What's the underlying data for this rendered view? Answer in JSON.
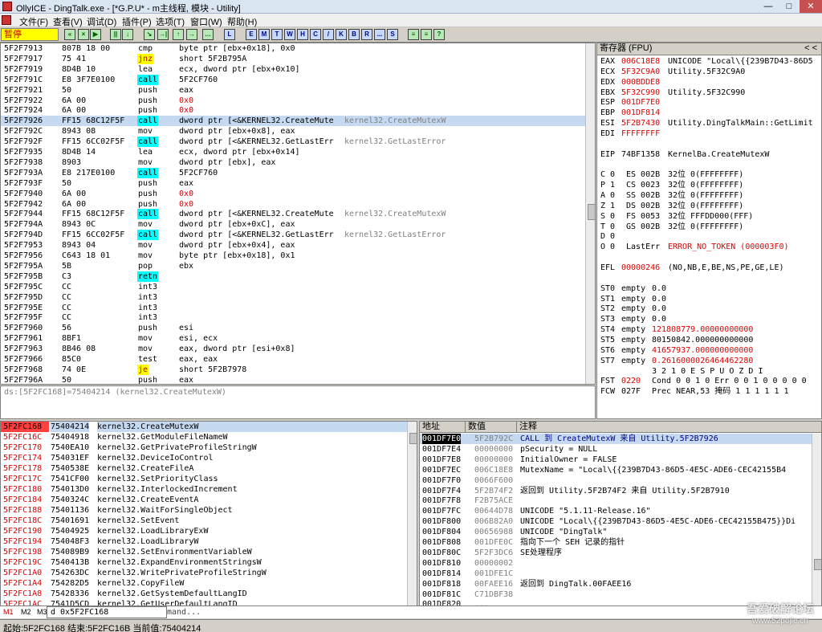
{
  "window": {
    "title": "OllyICE - DingTalk.exe - [*G.P.U* - m主线程, 模块 - Utility]",
    "minimize": "—",
    "maximize": "□",
    "close": "✕"
  },
  "menu": [
    "文件(F)",
    "查看(V)",
    "调试(D)",
    "插件(P)",
    "选项(T)",
    "窗口(W)",
    "帮助(H)"
  ],
  "toolbar": {
    "status": "暂停",
    "buttons": [
      "«",
      "×",
      "▶",
      "||",
      "↓",
      "↘",
      "→|",
      "↑",
      "→",
      "…",
      "L",
      "E",
      "M",
      "T",
      "W",
      "H",
      "C",
      "/",
      "K",
      "B",
      "R",
      "...",
      "S",
      "≡",
      "≡",
      "?"
    ]
  },
  "disasm": {
    "rows": [
      {
        "addr": "5F2F7913",
        "bytes": "807B 18 00",
        "mnem": "cmp",
        "ops": "byte ptr [ebx+0x18], 0x0",
        "cmt": "",
        "kind": "",
        "sel": false
      },
      {
        "addr": "5F2F7917",
        "bytes": "75 41",
        "mnem": "jnz",
        "ops": "short 5F2B795A",
        "cmt": "",
        "kind": "jmp",
        "sel": false
      },
      {
        "addr": "5F2F7919",
        "bytes": "8D4B 10",
        "mnem": "lea",
        "ops": "ecx, dword ptr [ebx+0x10]",
        "cmt": "",
        "kind": "",
        "sel": false
      },
      {
        "addr": "5F2F791C",
        "bytes": "E8 3F7E0100",
        "mnem": "call",
        "ops": "5F2CF760",
        "cmt": "",
        "kind": "call",
        "sel": false
      },
      {
        "addr": "5F2F7921",
        "bytes": "50",
        "mnem": "push",
        "ops": "eax",
        "cmt": "",
        "kind": "",
        "sel": false
      },
      {
        "addr": "5F2F7922",
        "bytes": "6A 00",
        "mnem": "push",
        "ops": "0x0",
        "cmt": "",
        "kind": "",
        "sel": false
      },
      {
        "addr": "5F2F7924",
        "bytes": "6A 00",
        "mnem": "push",
        "ops": "0x0",
        "cmt": "",
        "kind": "",
        "sel": false
      },
      {
        "addr": "5F2F7926",
        "bytes": "FF15 68C12F5F",
        "mnem": "call",
        "ops": "dword ptr [<&KERNEL32.CreateMute",
        "cmt": "kernel32.CreateMutexW",
        "kind": "call",
        "sel": true
      },
      {
        "addr": "5F2F792C",
        "bytes": "8943 08",
        "mnem": "mov",
        "ops": "dword ptr [ebx+0x8], eax",
        "cmt": "",
        "kind": "",
        "sel": false
      },
      {
        "addr": "5F2F792F",
        "bytes": "FF15 6CC02F5F",
        "mnem": "call",
        "ops": "dword ptr [<&KERNEL32.GetLastErr",
        "cmt": "kernel32.GetLastError",
        "kind": "call",
        "sel": false
      },
      {
        "addr": "5F2F7935",
        "bytes": "8D4B 14",
        "mnem": "lea",
        "ops": "ecx, dword ptr [ebx+0x14]",
        "cmt": "",
        "kind": "",
        "sel": false
      },
      {
        "addr": "5F2F7938",
        "bytes": "8903",
        "mnem": "mov",
        "ops": "dword ptr [ebx], eax",
        "cmt": "",
        "kind": "",
        "sel": false
      },
      {
        "addr": "5F2F793A",
        "bytes": "E8 217E0100",
        "mnem": "call",
        "ops": "5F2CF760",
        "cmt": "",
        "kind": "call",
        "sel": false
      },
      {
        "addr": "5F2F793F",
        "bytes": "50",
        "mnem": "push",
        "ops": "eax",
        "cmt": "",
        "kind": "",
        "sel": false
      },
      {
        "addr": "5F2F7940",
        "bytes": "6A 00",
        "mnem": "push",
        "ops": "0x0",
        "cmt": "",
        "kind": "",
        "sel": false
      },
      {
        "addr": "5F2F7942",
        "bytes": "6A 00",
        "mnem": "push",
        "ops": "0x0",
        "cmt": "",
        "kind": "",
        "sel": false
      },
      {
        "addr": "5F2F7944",
        "bytes": "FF15 68C12F5F",
        "mnem": "call",
        "ops": "dword ptr [<&KERNEL32.CreateMute",
        "cmt": "kernel32.CreateMutexW",
        "kind": "call",
        "sel": false
      },
      {
        "addr": "5F2F794A",
        "bytes": "8943 0C",
        "mnem": "mov",
        "ops": "dword ptr [ebx+0xC], eax",
        "cmt": "",
        "kind": "",
        "sel": false
      },
      {
        "addr": "5F2F794D",
        "bytes": "FF15 6CC02F5F",
        "mnem": "call",
        "ops": "dword ptr [<&KERNEL32.GetLastErr",
        "cmt": "kernel32.GetLastError",
        "kind": "call",
        "sel": false
      },
      {
        "addr": "5F2F7953",
        "bytes": "8943 04",
        "mnem": "mov",
        "ops": "dword ptr [ebx+0x4], eax",
        "cmt": "",
        "kind": "",
        "sel": false
      },
      {
        "addr": "5F2F7956",
        "bytes": "C643 18 01",
        "mnem": "mov",
        "ops": "byte ptr [ebx+0x18], 0x1",
        "cmt": "",
        "kind": "",
        "sel": false
      },
      {
        "addr": "5F2F795A",
        "bytes": "5B",
        "mnem": "pop",
        "ops": "ebx",
        "cmt": "",
        "kind": "",
        "sel": false
      },
      {
        "addr": "5F2F795B",
        "bytes": "C3",
        "mnem": "retn",
        "ops": "",
        "cmt": "",
        "kind": "ret",
        "sel": false
      },
      {
        "addr": "5F2F795C",
        "bytes": "CC",
        "mnem": "int3",
        "ops": "",
        "cmt": "",
        "kind": "",
        "sel": false
      },
      {
        "addr": "5F2F795D",
        "bytes": "CC",
        "mnem": "int3",
        "ops": "",
        "cmt": "",
        "kind": "",
        "sel": false
      },
      {
        "addr": "5F2F795E",
        "bytes": "CC",
        "mnem": "int3",
        "ops": "",
        "cmt": "",
        "kind": "",
        "sel": false
      },
      {
        "addr": "5F2F795F",
        "bytes": "CC",
        "mnem": "int3",
        "ops": "",
        "cmt": "",
        "kind": "",
        "sel": false
      },
      {
        "addr": "5F2F7960",
        "bytes": "56",
        "mnem": "push",
        "ops": "esi",
        "cmt": "",
        "kind": "",
        "sel": false
      },
      {
        "addr": "5F2F7961",
        "bytes": "8BF1",
        "mnem": "mov",
        "ops": "esi, ecx",
        "cmt": "",
        "kind": "",
        "sel": false
      },
      {
        "addr": "5F2F7963",
        "bytes": "8B46 08",
        "mnem": "mov",
        "ops": "eax, dword ptr [esi+0x8]",
        "cmt": "",
        "kind": "",
        "sel": false
      },
      {
        "addr": "5F2F7966",
        "bytes": "85C0",
        "mnem": "test",
        "ops": "eax, eax",
        "cmt": "",
        "kind": "",
        "sel": false
      },
      {
        "addr": "5F2F7968",
        "bytes": "74 0E",
        "mnem": "je",
        "ops": "short 5F2B7978",
        "cmt": "",
        "kind": "jmp",
        "sel": false
      },
      {
        "addr": "5F2F796A",
        "bytes": "50",
        "mnem": "push",
        "ops": "eax",
        "cmt": "",
        "kind": "",
        "sel": false
      }
    ],
    "info": "ds:[5F2FC168]=75404214 (kernel32.CreateMutexW)"
  },
  "registers": {
    "title": "寄存器 (FPU)",
    "nav": "<   <",
    "rows": [
      {
        "name": "EAX",
        "val": "006C18E8",
        "desc": "UNICODE \"Local\\{{239B7D43-86D5",
        "red": true
      },
      {
        "name": "ECX",
        "val": "5F32C9A0",
        "desc": "Utility.5F32C9A0",
        "red": true
      },
      {
        "name": "EDX",
        "val": "000BDDE8",
        "desc": "",
        "red": true
      },
      {
        "name": "EBX",
        "val": "5F32C990",
        "desc": "Utility.5F32C990",
        "red": true
      },
      {
        "name": "ESP",
        "val": "001DF7E0",
        "desc": "",
        "red": true
      },
      {
        "name": "EBP",
        "val": "001DF814",
        "desc": "",
        "red": true
      },
      {
        "name": "ESI",
        "val": "5F2B7430",
        "desc": "Utility.DingTalkMain::GetLimit",
        "red": true
      },
      {
        "name": "EDI",
        "val": "FFFFFFFF",
        "desc": "",
        "red": true
      },
      {
        "name": "",
        "val": "",
        "desc": "",
        "red": false
      },
      {
        "name": "EIP",
        "val": "74BF1358",
        "desc": "KernelBa.CreateMutexW",
        "red": false
      },
      {
        "name": "",
        "val": "",
        "desc": "",
        "red": false
      },
      {
        "name": "C 0",
        "val": "ES 002B",
        "desc": "32位 0(FFFFFFFF)",
        "red": false
      },
      {
        "name": "P 1",
        "val": "CS 0023",
        "desc": "32位 0(FFFFFFFF)",
        "red": false
      },
      {
        "name": "A 0",
        "val": "SS 002B",
        "desc": "32位 0(FFFFFFFF)",
        "red": false
      },
      {
        "name": "Z 1",
        "val": "DS 002B",
        "desc": "32位 0(FFFFFFFF)",
        "red": false
      },
      {
        "name": "S 0",
        "val": "FS 0053",
        "desc": "32位 FFFDD000(FFF)",
        "red": false
      },
      {
        "name": "T 0",
        "val": "GS 002B",
        "desc": "32位 0(FFFFFFFF)",
        "red": false
      },
      {
        "name": "D 0",
        "val": "",
        "desc": "",
        "red": false
      },
      {
        "name": "O 0",
        "val": "LastErr",
        "desc": "ERROR_NO_TOKEN (000003F0)",
        "red": false
      },
      {
        "name": "",
        "val": "",
        "desc": "",
        "red": false
      },
      {
        "name": "EFL",
        "val": "00000246",
        "desc": "(NO,NB,E,BE,NS,PE,GE,LE)",
        "red": false
      },
      {
        "name": "",
        "val": "",
        "desc": "",
        "red": false
      },
      {
        "name": "ST0",
        "val": "empty",
        "desc": "0.0",
        "red": false
      },
      {
        "name": "ST1",
        "val": "empty",
        "desc": "0.0",
        "red": false
      },
      {
        "name": "ST2",
        "val": "empty",
        "desc": "0.0",
        "red": false
      },
      {
        "name": "ST3",
        "val": "empty",
        "desc": "0.0",
        "red": false
      },
      {
        "name": "ST4",
        "val": "empty",
        "desc": "121808779.00000000000",
        "red": false
      },
      {
        "name": "ST5",
        "val": "empty",
        "desc": "80150842.000000000000",
        "red": false
      },
      {
        "name": "ST6",
        "val": "empty",
        "desc": "41657937.000000000000",
        "red": false
      },
      {
        "name": "ST7",
        "val": "empty",
        "desc": "0.2616000026464462280",
        "red": false
      },
      {
        "name": "",
        "val": "",
        "desc": "     3 2 1 0      E S P U O Z D I",
        "red": false
      },
      {
        "name": "FST",
        "val": "0220",
        "desc": "Cond 0 0 1 0  Err 0 0 1 0 0 0 0 0",
        "red": false
      },
      {
        "name": "FCW",
        "val": "027F",
        "desc": "Prec NEAR,53  掩码    1 1 1 1 1 1",
        "red": false
      }
    ]
  },
  "dump": {
    "rows": [
      {
        "addr": "5F2FC168",
        "val": "75404214",
        "sym": "kernel32.CreateMutexW",
        "sel": true
      },
      {
        "addr": "5F2FC16C",
        "val": "75404918",
        "sym": "kernel32.GetModuleFileNameW",
        "sel": false
      },
      {
        "addr": "5F2FC170",
        "val": "7540EA10",
        "sym": "kernel32.GetPrivateProfileStringW",
        "sel": false
      },
      {
        "addr": "5F2FC174",
        "val": "754031EF",
        "sym": "kernel32.DeviceIoControl",
        "sel": false
      },
      {
        "addr": "5F2FC178",
        "val": "7540538E",
        "sym": "kernel32.CreateFileA",
        "sel": false
      },
      {
        "addr": "5F2FC17C",
        "val": "7541CF00",
        "sym": "kernel32.SetPriorityClass",
        "sel": false
      },
      {
        "addr": "5F2FC180",
        "val": "754013D0",
        "sym": "kernel32.InterlockedIncrement",
        "sel": false
      },
      {
        "addr": "5F2FC184",
        "val": "7540324C",
        "sym": "kernel32.CreateEventA",
        "sel": false
      },
      {
        "addr": "5F2FC188",
        "val": "75401136",
        "sym": "kernel32.WaitForSingleObject",
        "sel": false
      },
      {
        "addr": "5F2FC18C",
        "val": "75401691",
        "sym": "kernel32.SetEvent",
        "sel": false
      },
      {
        "addr": "5F2FC190",
        "val": "75404925",
        "sym": "kernel32.LoadLibraryExW",
        "sel": false
      },
      {
        "addr": "5F2FC194",
        "val": "754048F3",
        "sym": "kernel32.LoadLibraryW",
        "sel": false
      },
      {
        "addr": "5F2FC198",
        "val": "754089B9",
        "sym": "kernel32.SetEnvironmentVariableW",
        "sel": false
      },
      {
        "addr": "5F2FC19C",
        "val": "7540413B",
        "sym": "kernel32.ExpandEnvironmentStringsW",
        "sel": false
      },
      {
        "addr": "5F2FC1A0",
        "val": "754263DC",
        "sym": "kernel32.WritePrivateProfileStringW",
        "sel": false
      },
      {
        "addr": "5F2FC1A4",
        "val": "754282D5",
        "sym": "kernel32.CopyFileW",
        "sel": false
      },
      {
        "addr": "5F2FC1A8",
        "val": "75428336",
        "sym": "kernel32.GetSystemDefaultLangID",
        "sel": false
      },
      {
        "addr": "5F2FC1AC",
        "val": "7541D5CD",
        "sym": "kernel32.GetUserDefaultLangID",
        "sel": false
      }
    ]
  },
  "stack": {
    "headers": [
      "地址",
      "数值",
      "注释"
    ],
    "rows": [
      {
        "addr": "001DF7E0",
        "val": "5F2B792C",
        "cmt": "CALL 到 CreateMutexW 来自 Utility.5F2B7926",
        "sel": true
      },
      {
        "addr": "001DF7E4",
        "val": "00000000",
        "cmt": "pSecurity = NULL",
        "sel": false
      },
      {
        "addr": "001DF7E8",
        "val": "00000000",
        "cmt": "InitialOwner = FALSE",
        "sel": false
      },
      {
        "addr": "001DF7EC",
        "val": "006C18E8",
        "cmt": "MutexName = \"Local\\{{239B7D43-86D5-4E5C-ADE6-CEC42155B4",
        "sel": false
      },
      {
        "addr": "001DF7F0",
        "val": "0066F600",
        "cmt": "",
        "sel": false
      },
      {
        "addr": "001DF7F4",
        "val": "5F2B74F2",
        "cmt": "返回到 Utility.5F2B74F2 来自 Utility.5F2B7910",
        "sel": false
      },
      {
        "addr": "001DF7F8",
        "val": "F2B75ACE",
        "cmt": "",
        "sel": false
      },
      {
        "addr": "001DF7FC",
        "val": "00644D78",
        "cmt": "UNICODE \"5.1.11-Release.16\"",
        "sel": false
      },
      {
        "addr": "001DF800",
        "val": "006B82A0",
        "cmt": "UNICODE \"Local\\{{239B7D43-86D5-4E5C-ADE6-CEC42155B475}}Di",
        "sel": false
      },
      {
        "addr": "001DF804",
        "val": "00656988",
        "cmt": "UNICODE \"DingTalk\"",
        "sel": false
      },
      {
        "addr": "001DF808",
        "val": "001DFE0C",
        "cmt": "指向下一个 SEH 记录的指针",
        "sel": false
      },
      {
        "addr": "001DF80C",
        "val": "5F2F3DC6",
        "cmt": "SE处理程序",
        "sel": false
      },
      {
        "addr": "001DF810",
        "val": "00000002",
        "cmt": "",
        "sel": false
      },
      {
        "addr": "001DF814",
        "val": "001DFE1C",
        "cmt": "",
        "sel": false
      },
      {
        "addr": "001DF818",
        "val": "00FAEE16",
        "cmt": "返回到 DingTalk.00FAEE16",
        "sel": false
      },
      {
        "addr": "001DF81C",
        "val": "C71DBF38",
        "cmt": "",
        "sel": false
      },
      {
        "addr": "001DF820",
        "val": "...",
        "cmt": "",
        "sel": false
      }
    ]
  },
  "cmdbar": {
    "m1": "M1",
    "m2": "M2",
    "m3": "M3",
    "cmd": "d 0x5F2FC168",
    "extra": "mand..."
  },
  "statusbar": {
    "text": "起始:5F2FC168 结束:5F2FC16B 当前值:75404214"
  },
  "watermark": {
    "line1": "吾爱破解论坛",
    "line2": "www.52pojie.cn"
  }
}
